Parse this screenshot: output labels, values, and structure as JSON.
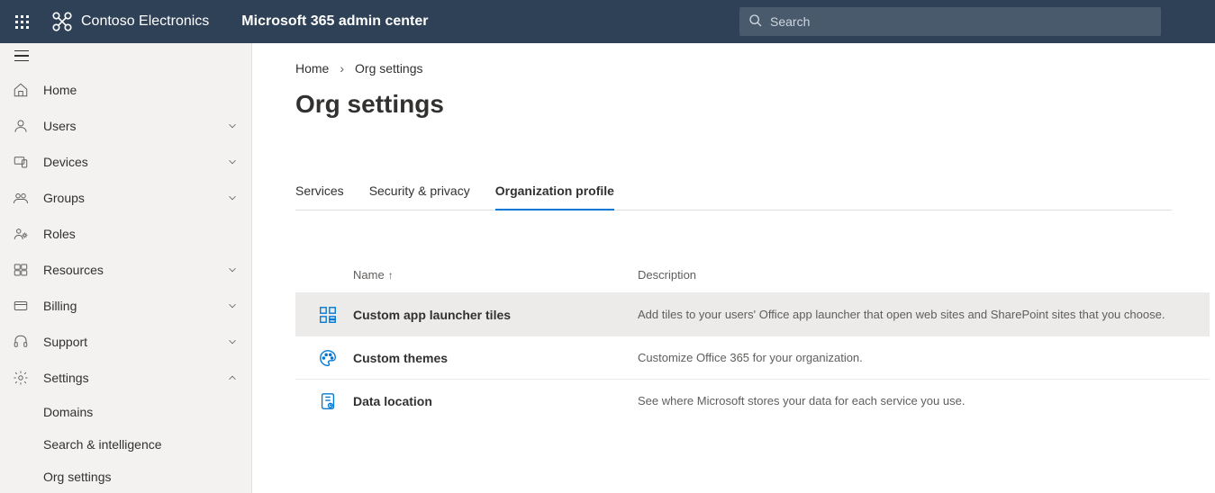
{
  "header": {
    "org_name": "Contoso Electronics",
    "app_name": "Microsoft 365 admin center",
    "search_placeholder": "Search"
  },
  "sidebar": {
    "items": [
      {
        "label": "Home",
        "expandable": false
      },
      {
        "label": "Users",
        "expandable": true
      },
      {
        "label": "Devices",
        "expandable": true
      },
      {
        "label": "Groups",
        "expandable": true
      },
      {
        "label": "Roles",
        "expandable": false
      },
      {
        "label": "Resources",
        "expandable": true
      },
      {
        "label": "Billing",
        "expandable": true
      },
      {
        "label": "Support",
        "expandable": true
      },
      {
        "label": "Settings",
        "expandable": true,
        "expanded": true
      }
    ],
    "settings_children": [
      {
        "label": "Domains"
      },
      {
        "label": "Search & intelligence"
      },
      {
        "label": "Org settings"
      }
    ]
  },
  "breadcrumb": {
    "home": "Home",
    "current": "Org settings"
  },
  "page_title": "Org settings",
  "tabs": [
    {
      "label": "Services"
    },
    {
      "label": "Security & privacy"
    },
    {
      "label": "Organization profile",
      "active": true
    }
  ],
  "table": {
    "columns": {
      "name": "Name",
      "description": "Description"
    },
    "rows": [
      {
        "name": "Custom app launcher tiles",
        "description": "Add tiles to your users' Office app launcher that open web sites and SharePoint sites that you choose.",
        "selected": true
      },
      {
        "name": "Custom themes",
        "description": "Customize Office 365 for your organization."
      },
      {
        "name": "Data location",
        "description": "See where Microsoft stores your data for each service you use."
      }
    ]
  }
}
